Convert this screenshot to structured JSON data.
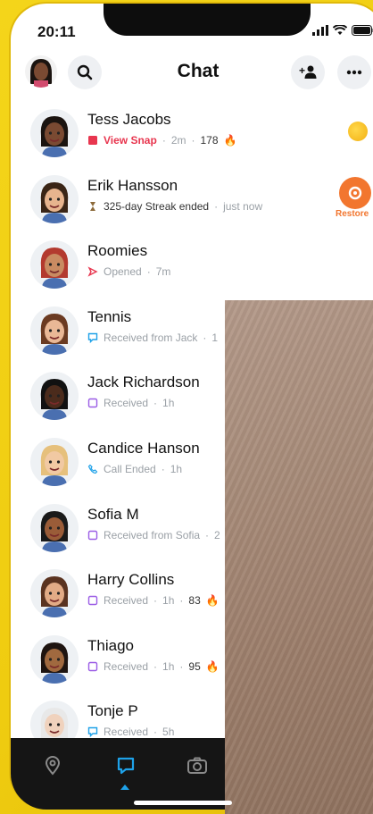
{
  "status": {
    "time": "20:11"
  },
  "header": {
    "title": "Chat"
  },
  "chats": [
    {
      "name": "Tess Jacobs",
      "status": "View Snap",
      "time": "2m",
      "streak": "178",
      "type": "snap-red",
      "skin": "#7a4a32",
      "hair": "#1b1410"
    },
    {
      "name": "Erik Hansson",
      "status": "325-day Streak ended",
      "time": "just now",
      "streak": "",
      "type": "hourglass",
      "skin": "#e7b48e",
      "hair": "#3a2516"
    },
    {
      "name": "Roomies",
      "status": "Opened",
      "time": "7m",
      "streak": "",
      "type": "opened",
      "skin": "#c98b62",
      "hair": "#b33a2f"
    },
    {
      "name": "Tennis",
      "status": "Received from Jack",
      "time": "1",
      "streak": "",
      "type": "chat-blue",
      "skin": "#e9b896",
      "hair": "#6b3b22"
    },
    {
      "name": "Jack Richardson",
      "status": "Received",
      "time": "1h",
      "streak": "",
      "type": "chat-purple",
      "skin": "#4b2b1c",
      "hair": "#111"
    },
    {
      "name": "Candice Hanson",
      "status": "Call Ended",
      "time": "1h",
      "streak": "",
      "type": "call",
      "skin": "#f1c9a3",
      "hair": "#e6c07c"
    },
    {
      "name": "Sofia M",
      "status": "Received from Sofia",
      "time": "2",
      "streak": "",
      "type": "chat-purple",
      "skin": "#9a5c38",
      "hair": "#1a1a1a"
    },
    {
      "name": "Harry Collins",
      "status": "Received",
      "time": "1h",
      "streak": "83",
      "type": "chat-purple",
      "skin": "#e2ab86",
      "hair": "#5a3320"
    },
    {
      "name": "Thiago",
      "status": "Received",
      "time": "1h",
      "streak": "95",
      "type": "chat-purple",
      "skin": "#a0693f",
      "hair": "#1e1410"
    },
    {
      "name": "Tonje P",
      "status": "Received",
      "time": "5h",
      "streak": "",
      "type": "chat-blue",
      "skin": "#f0d2bd",
      "hair": "#e8e8e8"
    }
  ],
  "side": {
    "restore_label": "Restore"
  }
}
